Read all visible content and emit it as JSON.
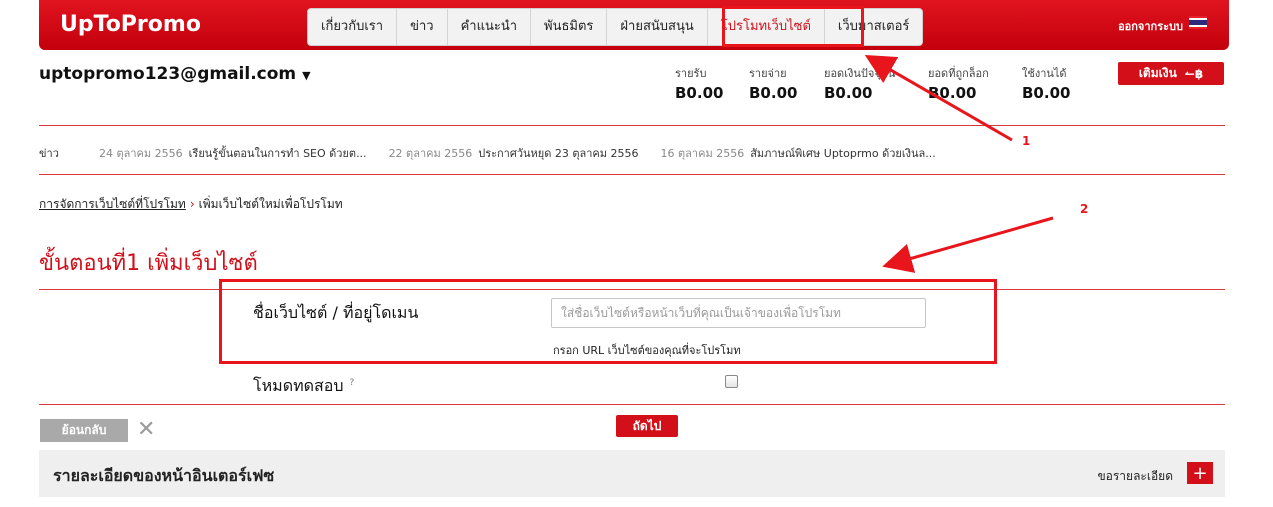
{
  "header": {
    "logo": "UpToPromo",
    "nav": [
      "เกี่ยวกับเรา",
      "ข่าว",
      "คำแนะนำ",
      "พันธมิตร",
      "ฝ่ายสนับสนุน",
      "โปรโมทเว็บไซต์",
      "เว็บมาสเตอร์"
    ],
    "active_nav": "โปรโมทเว็บไซต์",
    "logout": "ออกจากระบบ",
    "flag_icon": "thai-flag-icon"
  },
  "account": {
    "email": "uptopromo123@gmail.com",
    "caret": "▼",
    "stats": [
      {
        "label": "รายรับ",
        "value": "B0.00"
      },
      {
        "label": "รายจ่าย",
        "value": "B0.00"
      },
      {
        "label": "ยอดเงินปัจจุบัน",
        "value": "B0.00"
      },
      {
        "label": "ยอดที่ถูกล็อก",
        "value": "B0.00"
      },
      {
        "label": "ใช้งานได้",
        "value": "B0.00"
      }
    ],
    "topup_label": "เติมเงิน",
    "topup_icon": "↼฿"
  },
  "news": {
    "label": "ข่าว",
    "items": [
      {
        "date": "24 ตุลาคม 2556",
        "text": "เรียนรู้ขั้นตอนในการทำ SEO ด้วยต..."
      },
      {
        "date": "22 ตุลาคม 2556",
        "text": "ประกาศวันหยุด 23 ตุลาคม 2556"
      },
      {
        "date": "16 ตุลาคม 2556",
        "text": "สัมภาษณ์พิเศษ Uptoprmo ด้วยเงินล..."
      }
    ]
  },
  "breadcrumb": {
    "link": "การจัดการเว็บไซต์ที่โปรโมท",
    "separator": "›",
    "current": "เพิ่มเว็บไซต์ใหม่เพื่อโปรโมท"
  },
  "step_title": "ขั้นตอนที่1 เพิ่มเว็บไซต์",
  "form": {
    "site_label": "ชื่อเว็บไซต์ / ที่อยู่โดเมน",
    "site_placeholder": "ใส่ชื่อเว็บไซต์หรือหน้าเว็บที่คุณเป็นเจ้าของเพื่อโปรโมท",
    "site_hint": "กรอก URL เว็บไซต์ของคุณที่จะโปรโมท",
    "test_mode_label": "โหมดทดสอบ",
    "help_mark": "?",
    "test_mode_checked": false
  },
  "actions": {
    "back": "ย้อนกลับ",
    "close": "✕",
    "next": "ถัดไป"
  },
  "details": {
    "title": "รายละเอียดของหน้าอินเตอร์เฟซ",
    "link": "ขอรายละเอียด",
    "plus": "+"
  },
  "annotations": [
    "1",
    "2"
  ],
  "colors": {
    "brand_red": "#d3101a",
    "annotation_red": "#e8161c"
  }
}
